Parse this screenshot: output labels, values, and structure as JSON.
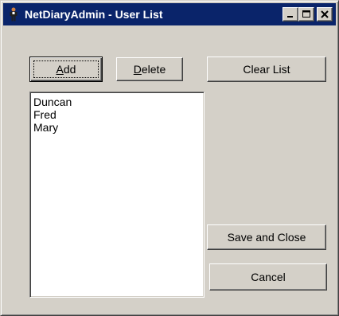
{
  "window": {
    "title": "NetDiaryAdmin - User List"
  },
  "buttons": {
    "add": {
      "pre": "",
      "accel": "A",
      "post": "dd"
    },
    "delete": {
      "pre": "",
      "accel": "D",
      "post": "elete"
    },
    "clear_list": "Clear List",
    "save_and_close": "Save and Close",
    "cancel": "Cancel"
  },
  "users": [
    "Duncan",
    "Fred",
    "Mary"
  ],
  "icons": {
    "app": "user-figure-icon",
    "minimize": "minimize-icon",
    "maximize": "maximize-icon",
    "close": "close-icon"
  },
  "colors": {
    "titlebar": "#0a246a",
    "face": "#d4d0c8"
  }
}
